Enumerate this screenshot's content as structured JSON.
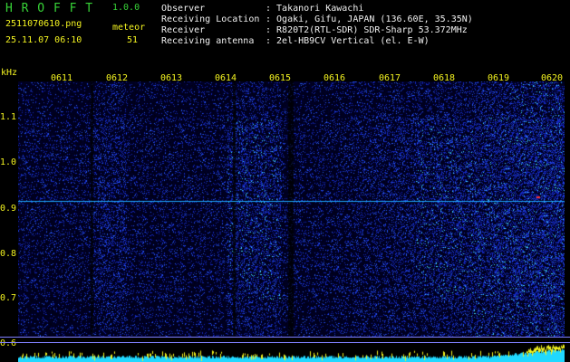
{
  "header": {
    "app_name": "H R O F F T",
    "version": "1.0.0",
    "filename": "2511070610.png",
    "datetime": "25.11.07 06:10",
    "meteor_label": "meteor",
    "meteor_count": "51",
    "info": [
      {
        "key": "Observer",
        "value": ": Takanori Kawachi"
      },
      {
        "key": "Receiving Location",
        "value": ": Ogaki, Gifu, JAPAN (136.60E, 35.35N)"
      },
      {
        "key": "Receiver",
        "value": ": R820T2(RTL-SDR) SDR-Sharp 53.372MHz"
      },
      {
        "key": "Receiving antenna",
        "value": ": 2el-HB9CV Vertical (el. E-W)"
      }
    ]
  },
  "axes": {
    "y_unit": "kHz",
    "y_ticks": [
      "1.1",
      "1.0",
      "0.9",
      "0.8",
      "0.7",
      "0.6"
    ],
    "x_ticks": [
      "0611",
      "0612",
      "0613",
      "0614",
      "0615",
      "0616",
      "0617",
      "0618",
      "0619",
      "0620"
    ]
  },
  "colors": {
    "background": "#000000",
    "header_text": "#f0f0f0",
    "title_green": "#37d337",
    "axis_yellow": "#f3f320",
    "noise_blue": "#1a2fd0",
    "signal_cyan": "#40e0ff"
  }
}
